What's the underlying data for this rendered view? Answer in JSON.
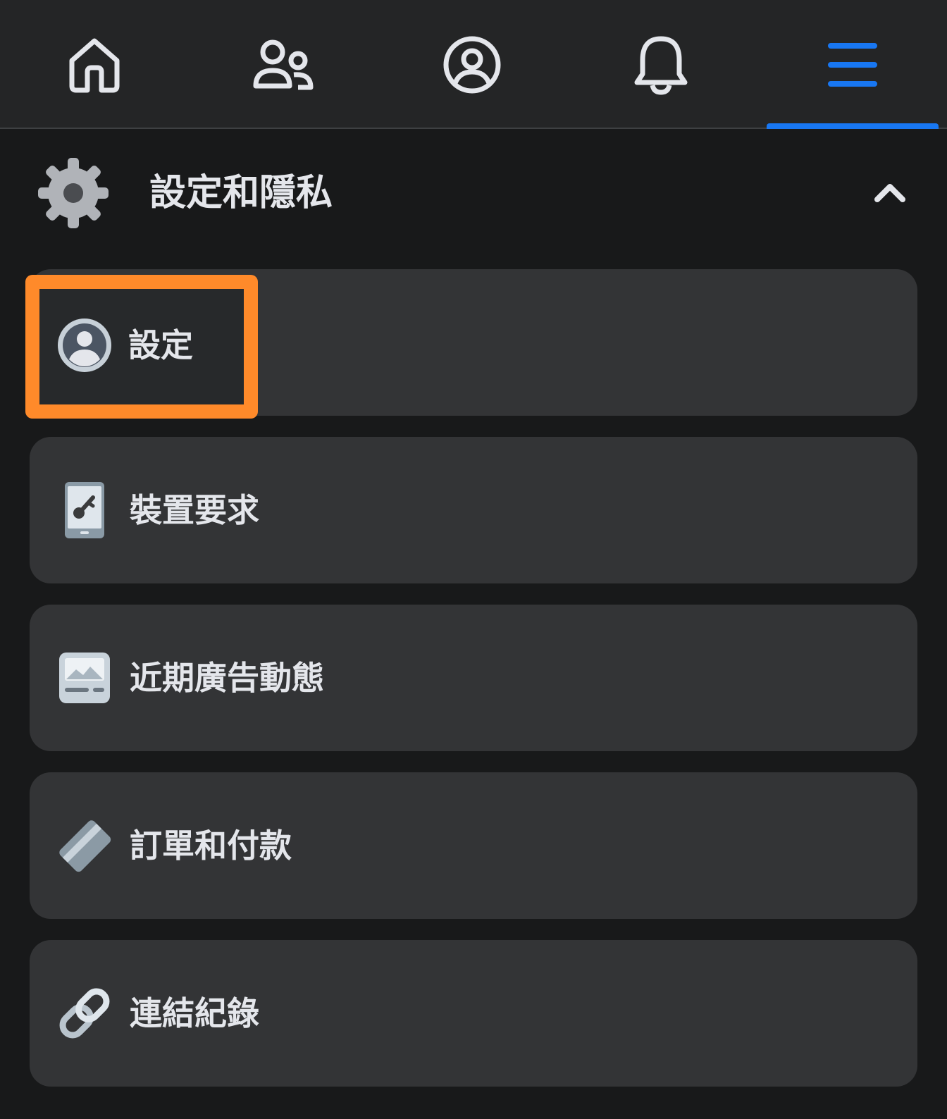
{
  "nav": {
    "tabs": [
      {
        "icon": "home-icon",
        "active": false
      },
      {
        "icon": "friends-icon",
        "active": false
      },
      {
        "icon": "profile-icon",
        "active": false
      },
      {
        "icon": "bell-icon",
        "active": false
      },
      {
        "icon": "menu-icon",
        "active": true
      }
    ],
    "active_color": "#1877f2",
    "inactive_color": "#e4e6eb"
  },
  "section": {
    "title": "設定和隱私",
    "icon": "gear-icon",
    "expanded": true
  },
  "items": [
    {
      "label": "設定",
      "icon": "account-settings-icon",
      "highlighted": true
    },
    {
      "label": "裝置要求",
      "icon": "device-key-icon",
      "highlighted": false
    },
    {
      "label": "近期廣告動態",
      "icon": "ad-activity-icon",
      "highlighted": false
    },
    {
      "label": "訂單和付款",
      "icon": "payment-card-icon",
      "highlighted": false
    },
    {
      "label": "連結紀錄",
      "icon": "link-icon",
      "highlighted": false
    }
  ],
  "highlight_color": "#ff8a2a"
}
